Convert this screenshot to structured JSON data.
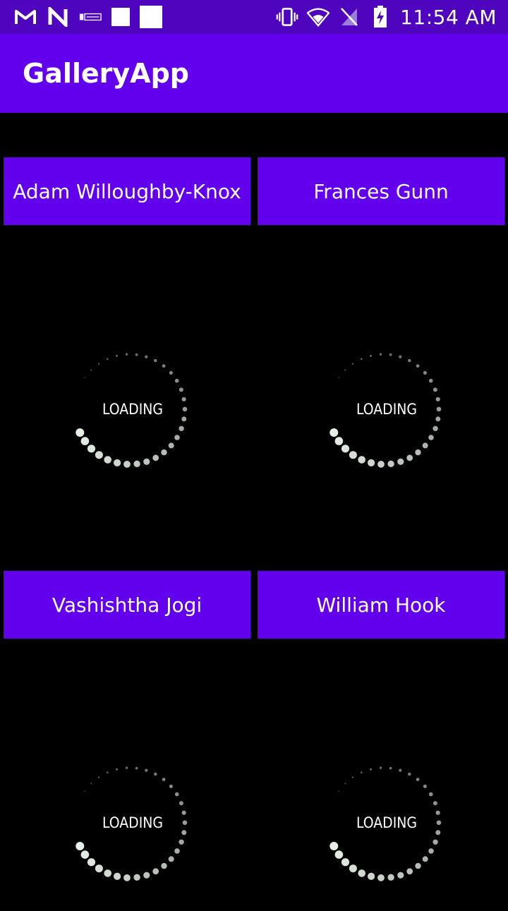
{
  "status_bar": {
    "time": "11:54 AM",
    "icons": [
      "gmail-icon",
      "n-notification-icon",
      "sim-icon",
      "square-notification-icon",
      "square-notification-icon",
      "vibrate-icon",
      "wifi-icon",
      "no-sim-icon",
      "battery-charging-icon"
    ]
  },
  "app_bar": {
    "title": "GalleryApp"
  },
  "gallery": {
    "items": [
      {
        "author": "Adam Willoughby-Knox",
        "loading_label": "LOADING"
      },
      {
        "author": "Frances Gunn",
        "loading_label": "LOADING"
      },
      {
        "author": "Vashishtha Jogi",
        "loading_label": "LOADING"
      },
      {
        "author": "William Hook",
        "loading_label": "LOADING"
      }
    ]
  },
  "colors": {
    "status_bar": "#4e05bd",
    "primary": "#6200ee",
    "background": "#000000",
    "text": "#ffffff"
  }
}
